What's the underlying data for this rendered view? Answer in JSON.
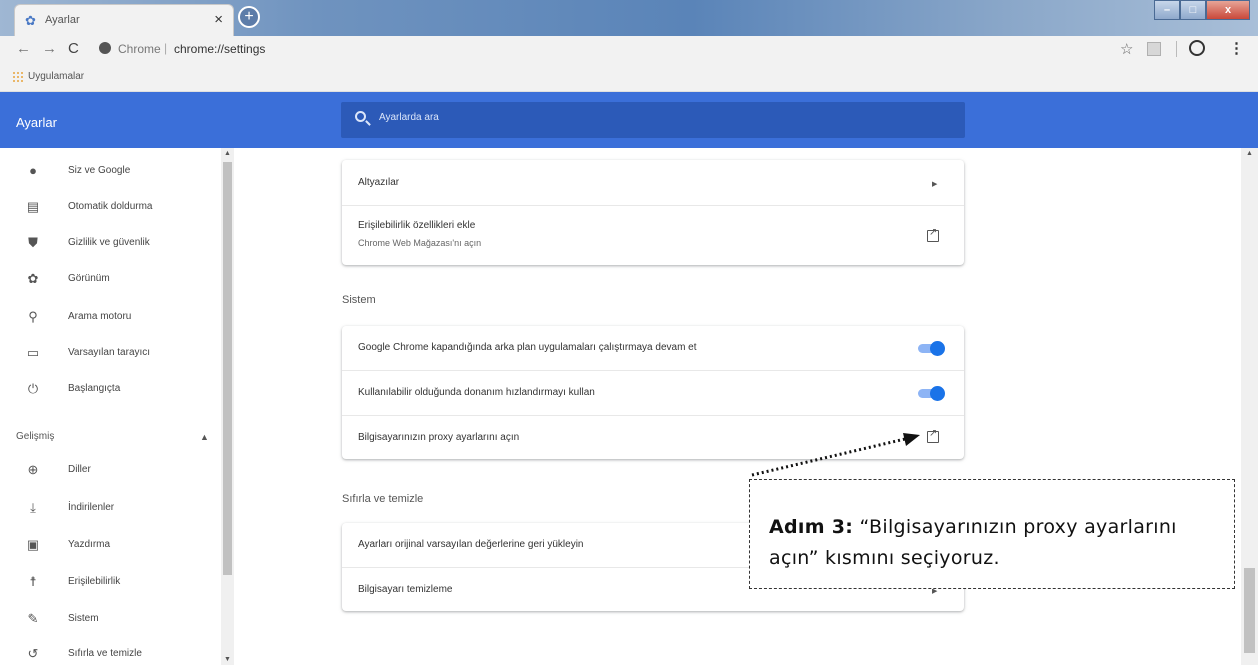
{
  "browser": {
    "tab_title": "Ayarlar",
    "tab_close": "×",
    "new_tab": "+",
    "win_minimize": "–",
    "win_maximize": "□",
    "win_close": "x",
    "omnibox_origin": "Chrome",
    "omnibox_separator": "|",
    "omnibox_url": "chrome://settings",
    "bookmarks": {
      "apps_label": "Uygulamalar"
    }
  },
  "header": {
    "title": "Ayarlar",
    "search_placeholder": "Ayarlarda ara"
  },
  "sidebar": {
    "items": [
      {
        "label": "Siz ve Google",
        "icon": "person-icon"
      },
      {
        "label": "Otomatik doldurma",
        "icon": "clipboard-icon"
      },
      {
        "label": "Gizlilik ve güvenlik",
        "icon": "shield-icon"
      },
      {
        "label": "Görünüm",
        "icon": "palette-icon"
      },
      {
        "label": "Arama motoru",
        "icon": "search-icon"
      },
      {
        "label": "Varsayılan tarayıcı",
        "icon": "browser-icon"
      },
      {
        "label": "Başlangıçta",
        "icon": "power-icon"
      }
    ],
    "advanced_label": "Gelişmiş",
    "advanced_items": [
      {
        "label": "Diller",
        "icon": "globe-icon"
      },
      {
        "label": "İndirilenler",
        "icon": "download-icon"
      },
      {
        "label": "Yazdırma",
        "icon": "printer-icon"
      },
      {
        "label": "Erişilebilirlik",
        "icon": "accessibility-icon"
      },
      {
        "label": "Sistem",
        "icon": "wrench-icon"
      },
      {
        "label": "Sıfırla ve temizle",
        "icon": "reset-icon"
      }
    ]
  },
  "main": {
    "accessibility_card": {
      "captions_label": "Altyazılar",
      "add_features_label": "Erişilebilirlik özellikleri ekle",
      "add_features_sub": "Chrome Web Mağazası'nı açın"
    },
    "system_title": "Sistem",
    "system_card": {
      "background_apps_label": "Google Chrome kapandığında arka plan uygulamaları çalıştırmaya devam et",
      "background_apps_on": true,
      "hardware_accel_label": "Kullanılabilir olduğunda donanım hızlandırmayı kullan",
      "hardware_accel_on": true,
      "proxy_label": "Bilgisayarınızın proxy ayarlarını açın"
    },
    "reset_title": "Sıfırla ve temizle",
    "reset_card": {
      "restore_label": "Ayarları orijinal varsayılan değerlerine geri yükleyin",
      "cleanup_label": "Bilgisayarı temizleme"
    }
  },
  "annotation": {
    "step_label": "Adım 3:",
    "text": "“Bilgisayarınızın proxy ayarlarını açın” kısmını seçiyoruz."
  },
  "colors": {
    "header": "#3b6fd9",
    "search_box": "#2c5ab8",
    "toggle_on": "#1a73e8"
  }
}
